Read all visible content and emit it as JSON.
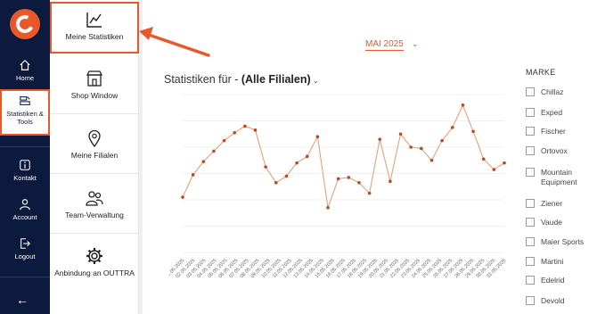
{
  "sidebar": {
    "items": [
      {
        "label": "Home",
        "icon": "home-icon"
      },
      {
        "label": "Statistiken & Tools",
        "icon": "tools-icon"
      },
      {
        "label": "Kontakt",
        "icon": "info-icon"
      },
      {
        "label": "Account",
        "icon": "user-icon"
      },
      {
        "label": "Logout",
        "icon": "logout-icon"
      }
    ],
    "back_label": "←"
  },
  "submenu": {
    "items": [
      {
        "label": "Meine Statistiken",
        "icon": "chart-icon"
      },
      {
        "label": "Shop Window",
        "icon": "shop-icon"
      },
      {
        "label": "Meine Filialen",
        "icon": "location-pin-icon"
      },
      {
        "label": "Team-Verwaltung",
        "icon": "team-icon"
      },
      {
        "label": "Anbindung an OUTTRA",
        "icon": "gear-icon"
      }
    ]
  },
  "header": {
    "month": "MAI 2025",
    "stat_prefix": "Statistiken für - ",
    "stat_selection": "(Alle Filialen)"
  },
  "brands": {
    "title": "MARKE",
    "items": [
      "Chillaz",
      "Exped",
      "Fischer",
      "Ortovox",
      "Mountain Equipment",
      "Ziener",
      "Vaude",
      "Maier Sports",
      "Martini",
      "Edelrid",
      "Devold"
    ]
  },
  "colors": {
    "accent": "#e8582a",
    "sidebar_bg": "#0c1a3e",
    "line": "#e8a07a",
    "point": "#b84a26"
  },
  "chart_data": {
    "type": "line",
    "x": [
      "01.05.2025",
      "02.05.2025",
      "03.05.2025",
      "04.05.2025",
      "05.05.2025",
      "06.05.2025",
      "07.05.2025",
      "08.05.2025",
      "09.05.2025",
      "10.05.2025",
      "11.05.2025",
      "12.05.2025",
      "13.05.2025",
      "14.05.2025",
      "15.05.2025",
      "16.05.2025",
      "17.05.2025",
      "18.05.2025",
      "19.05.2025",
      "20.05.2025",
      "21.05.2025",
      "22.05.2025",
      "23.05.2025",
      "24.05.2025",
      "25.05.2025",
      "26.05.2025",
      "27.05.2025",
      "28.05.2025",
      "29.05.2025",
      "30.05.2025",
      "31.05.2025"
    ],
    "values": [
      42,
      59,
      69,
      77,
      85,
      91,
      96,
      93,
      65,
      53,
      58,
      68,
      73,
      88,
      34,
      56,
      57,
      53,
      45,
      86,
      54,
      90,
      80,
      79,
      70,
      85,
      95,
      112,
      92,
      71,
      63,
      68
    ],
    "grid": true
  }
}
